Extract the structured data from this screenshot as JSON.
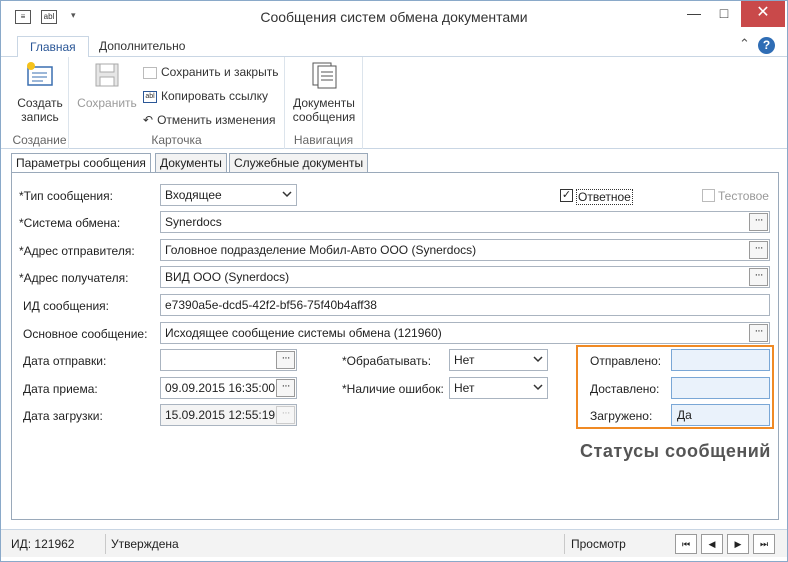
{
  "window": {
    "title": "Сообщения систем обмена документами",
    "min_label": "—",
    "max_label": "□",
    "close_label": "✕"
  },
  "ribbon_tabs": [
    "Главная",
    "Дополнительно"
  ],
  "ribbon": {
    "create": "Создать запись",
    "create_group": "Создание",
    "save": "Сохранить",
    "save_close": "Сохранить и закрыть",
    "copy_link": "Копировать ссылку",
    "undo": "Отменить изменения",
    "card_group": "Карточка",
    "docs": "Документы сообщения",
    "nav_group": "Навигация"
  },
  "tabs": [
    "Параметры сообщения",
    "Документы",
    "Служебные документы"
  ],
  "form": {
    "msg_type_label": "*Тип сообщения:",
    "msg_type_value": "Входящее",
    "reply_label": "Ответное",
    "reply_checked": "✓",
    "test_label": "Тестовое",
    "exchange_label": "*Система обмена:",
    "exchange_value": "Synerdocs",
    "sender_label": "*Адрес отправителя:",
    "sender_value": "Головное подразделение  Мобил-Авто ООО (Synerdocs)",
    "recipient_label": "*Адрес получателя:",
    "recipient_value": "ВИД ООО (Synerdocs)",
    "msg_id_label": "ИД сообщения:",
    "msg_id_value": "e7390a5e-dcd5-42f2-bf56-75f40b4aff38",
    "main_msg_label": "Основное сообщение:",
    "main_msg_value": "Исходящее сообщение системы обмена (121960)",
    "sent_date_label": "Дата отправки:",
    "sent_date_value": "",
    "recv_date_label": "Дата приема:",
    "recv_date_value": "09.09.2015 16:35:00",
    "load_date_label": "Дата загрузки:",
    "load_date_value": "15.09.2015 12:55:19",
    "process_label": "*Обрабатывать:",
    "process_value": "Нет",
    "errors_label": "*Наличие ошибок:",
    "errors_value": "Нет",
    "sent_status_label": "Отправлено:",
    "sent_status_value": "",
    "delivered_label": "Доставлено:",
    "delivered_value": "",
    "loaded_label": "Загружено:",
    "loaded_value": "Да",
    "dots": "···"
  },
  "annotation": "Статусы сообщений",
  "statusbar": {
    "id": "ИД: 121962",
    "state": "Утверждена",
    "mode": "Просмотр"
  },
  "nav": [
    "⏮",
    "◀",
    "▶",
    "⏭"
  ],
  "colors": {
    "accent": "#2b5797",
    "highlight": "#f08a24",
    "close": "#c9494a"
  }
}
